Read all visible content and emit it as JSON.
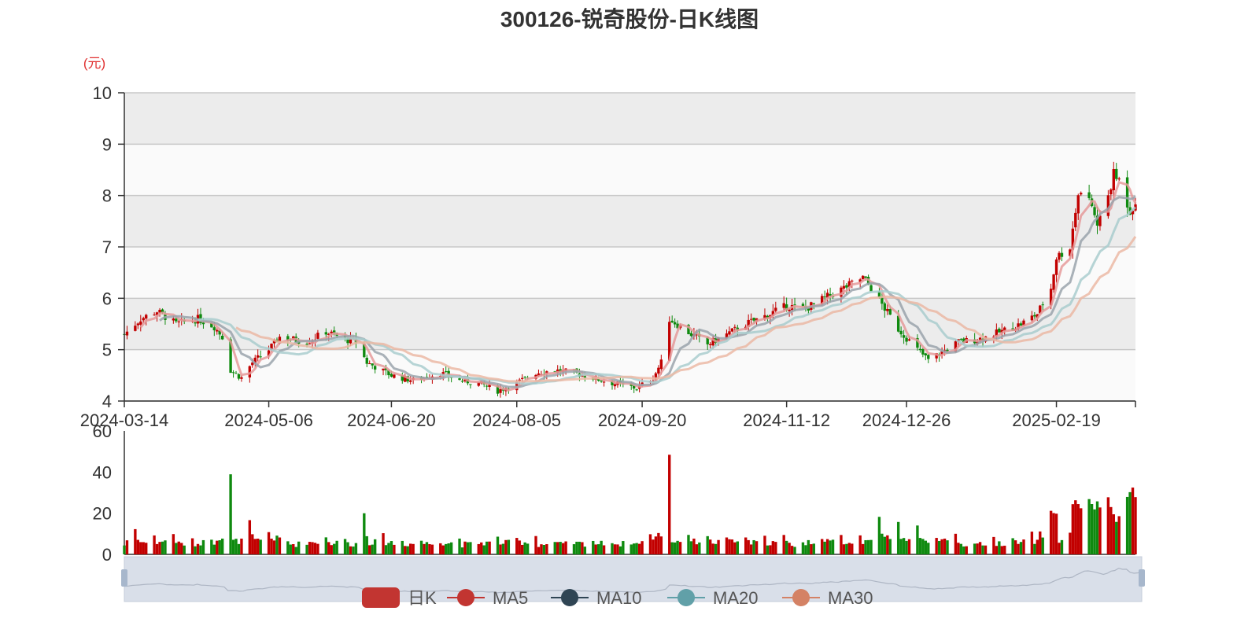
{
  "chart_data": {
    "type": "candlestick",
    "title": "300126-锐奇股份-日K线图",
    "y_unit": "(元)",
    "price_axis": {
      "ylim": [
        4,
        10
      ],
      "ticks": [
        "4",
        "5",
        "6",
        "7",
        "8",
        "9",
        "10"
      ]
    },
    "volume_axis": {
      "ylim": [
        0,
        60
      ],
      "ticks": [
        "0",
        "20",
        "40",
        "60"
      ]
    },
    "x_ticks": [
      "2024-03-14",
      "2024-05-06",
      "2024-06-20",
      "2024-08-05",
      "2024-09-20",
      "2024-11-12",
      "2024-12-26",
      "2025-02-19"
    ],
    "grid": true,
    "legend_position": "bottom",
    "legend": [
      {
        "name": "日K",
        "color": "#c23531"
      },
      {
        "name": "MA5",
        "color": "#c23531"
      },
      {
        "name": "MA10",
        "color": "#2f4554"
      },
      {
        "name": "MA20",
        "color": "#61a0a8"
      },
      {
        "name": "MA30",
        "color": "#d48265"
      }
    ],
    "colors": {
      "up": "#c20000",
      "down": "#0f8a0f",
      "ma5": "#e59a9a",
      "ma10": "#9aa3ab",
      "ma20": "#a9ccce",
      "ma30": "#ebb8a5"
    },
    "approx_close_path": [
      {
        "x": "2024-03-14",
        "y": 5.3
      },
      {
        "x": "2024-03-20",
        "y": 5.6
      },
      {
        "x": "2024-03-26",
        "y": 5.75
      },
      {
        "x": "2024-04-02",
        "y": 5.5
      },
      {
        "x": "2024-04-10",
        "y": 5.6
      },
      {
        "x": "2024-04-16",
        "y": 5.45
      },
      {
        "x": "2024-04-19",
        "y": 5.25
      },
      {
        "x": "2024-04-22",
        "y": 4.6
      },
      {
        "x": "2024-04-26",
        "y": 4.45
      },
      {
        "x": "2024-04-30",
        "y": 4.75
      },
      {
        "x": "2024-05-06",
        "y": 5.0
      },
      {
        "x": "2024-05-10",
        "y": 5.25
      },
      {
        "x": "2024-05-20",
        "y": 5.15
      },
      {
        "x": "2024-05-27",
        "y": 5.35
      },
      {
        "x": "2024-06-03",
        "y": 5.2
      },
      {
        "x": "2024-06-07",
        "y": 5.15
      },
      {
        "x": "2024-06-11",
        "y": 4.75
      },
      {
        "x": "2024-06-20",
        "y": 4.5
      },
      {
        "x": "2024-06-28",
        "y": 4.4
      },
      {
        "x": "2024-07-08",
        "y": 4.55
      },
      {
        "x": "2024-07-15",
        "y": 4.4
      },
      {
        "x": "2024-07-22",
        "y": 4.35
      },
      {
        "x": "2024-07-29",
        "y": 4.2
      },
      {
        "x": "2024-08-05",
        "y": 4.35
      },
      {
        "x": "2024-08-12",
        "y": 4.55
      },
      {
        "x": "2024-08-19",
        "y": 4.6
      },
      {
        "x": "2024-08-26",
        "y": 4.55
      },
      {
        "x": "2024-09-02",
        "y": 4.45
      },
      {
        "x": "2024-09-09",
        "y": 4.35
      },
      {
        "x": "2024-09-18",
        "y": 4.25
      },
      {
        "x": "2024-09-24",
        "y": 4.45
      },
      {
        "x": "2024-09-27",
        "y": 4.75
      },
      {
        "x": "2024-09-30",
        "y": 5.6
      },
      {
        "x": "2024-10-08",
        "y": 5.3
      },
      {
        "x": "2024-10-14",
        "y": 5.1
      },
      {
        "x": "2024-10-21",
        "y": 5.3
      },
      {
        "x": "2024-10-28",
        "y": 5.5
      },
      {
        "x": "2024-11-04",
        "y": 5.65
      },
      {
        "x": "2024-11-12",
        "y": 5.85
      },
      {
        "x": "2024-11-19",
        "y": 5.8
      },
      {
        "x": "2024-11-26",
        "y": 6.0
      },
      {
        "x": "2024-12-03",
        "y": 6.2
      },
      {
        "x": "2024-12-10",
        "y": 6.4
      },
      {
        "x": "2024-12-13",
        "y": 6.2
      },
      {
        "x": "2024-12-18",
        "y": 5.8
      },
      {
        "x": "2024-12-23",
        "y": 5.4
      },
      {
        "x": "2024-12-30",
        "y": 5.0
      },
      {
        "x": "2025-01-03",
        "y": 4.8
      },
      {
        "x": "2025-01-08",
        "y": 4.95
      },
      {
        "x": "2025-01-14",
        "y": 5.15
      },
      {
        "x": "2025-01-21",
        "y": 5.2
      },
      {
        "x": "2025-01-27",
        "y": 5.3
      },
      {
        "x": "2025-02-06",
        "y": 5.5
      },
      {
        "x": "2025-02-12",
        "y": 5.7
      },
      {
        "x": "2025-02-17",
        "y": 6.2
      },
      {
        "x": "2025-02-19",
        "y": 6.8
      },
      {
        "x": "2025-02-24",
        "y": 7.0
      },
      {
        "x": "2025-02-27",
        "y": 8.1
      },
      {
        "x": "2025-03-04",
        "y": 7.8
      },
      {
        "x": "2025-03-06",
        "y": 7.4
      },
      {
        "x": "2025-03-10",
        "y": 8.0
      },
      {
        "x": "2025-03-12",
        "y": 8.4
      },
      {
        "x": "2025-03-14",
        "y": 8.3
      },
      {
        "x": "2025-03-18",
        "y": 7.7
      },
      {
        "x": "2025-03-20",
        "y": 7.9
      }
    ],
    "volume_peak": 50
  }
}
